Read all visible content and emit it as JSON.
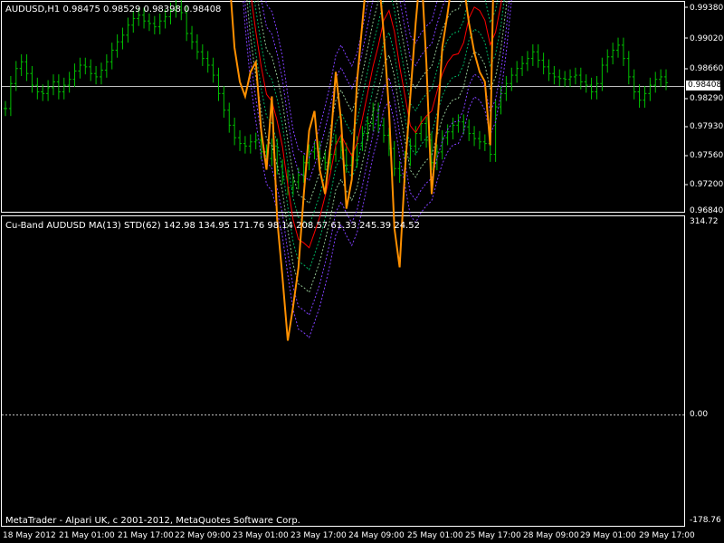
{
  "main_panel": {
    "title": "AUDUSD,H1  0.98475 0.98529 0.98398 0.98408",
    "price_ticks": [
      "0.99380",
      "0.99020",
      "0.98660",
      "0.98290",
      "0.97930",
      "0.97560",
      "0.97200",
      "0.96840"
    ],
    "current_price": "0.98408"
  },
  "indicator_panel": {
    "title": "Cu-Band AUDUSD  MA(13) STD(62)  142.98 134.95 171.76 98.14 208.57 61.33 245.39 24.52",
    "ticks": [
      "314.72",
      "0.00",
      "-178.76"
    ]
  },
  "footer": {
    "copyright": "MetaTrader - Alpari UK, c 2001-2012, MetaQuotes Software Corp."
  },
  "date_axis": [
    "18 May 2012",
    "21 May 01:00",
    "21 May 17:00",
    "22 May 09:00",
    "23 May 01:00",
    "23 May 17:00",
    "24 May 09:00",
    "25 May 01:00",
    "25 May 17:00",
    "28 May 09:00",
    "29 May 01:00",
    "29 May 17:00"
  ],
  "colors": {
    "background": "#000000",
    "grid": "#ffffff",
    "bars": "#00c000",
    "line": "#ff9000",
    "ma": "#ff0000",
    "inner_band": "#00b060",
    "mid_band": "#90c090",
    "outer_band": "#8040ff"
  },
  "chart_data": {
    "type": "line",
    "price_ohlc_closes": [
      0.981,
      0.984,
      0.9858,
      0.9866,
      0.9852,
      0.9838,
      0.983,
      0.9828,
      0.9835,
      0.9842,
      0.983,
      0.9838,
      0.9845,
      0.9855,
      0.9862,
      0.986,
      0.9852,
      0.9848,
      0.9856,
      0.9866,
      0.988,
      0.989,
      0.9898,
      0.991,
      0.9918,
      0.9922,
      0.9915,
      0.9912,
      0.9908,
      0.9915,
      0.992,
      0.9928,
      0.9932,
      0.9925,
      0.99,
      0.989,
      0.9878,
      0.987,
      0.9862,
      0.985,
      0.9828,
      0.9808,
      0.979,
      0.9775,
      0.9768,
      0.9765,
      0.977,
      0.9772,
      0.9758,
      0.975,
      0.9765,
      0.974,
      0.9728,
      0.9715,
      0.9722,
      0.973,
      0.9745,
      0.9758,
      0.9762,
      0.975,
      0.9745,
      0.9755,
      0.977,
      0.976,
      0.9742,
      0.9748,
      0.9768,
      0.978,
      0.9792,
      0.9808,
      0.979,
      0.9778,
      0.9762,
      0.9738,
      0.973,
      0.975,
      0.9765,
      0.978,
      0.9792,
      0.9772,
      0.9745,
      0.9758,
      0.9775,
      0.9782,
      0.979,
      0.9794,
      0.9788,
      0.978,
      0.9774,
      0.977,
      0.9768,
      0.9755,
      0.9812,
      0.9828,
      0.984,
      0.985,
      0.9858,
      0.9864,
      0.987,
      0.9878,
      0.9868,
      0.986,
      0.9852,
      0.9848,
      0.9846,
      0.9845,
      0.9848,
      0.985,
      0.9842,
      0.9838,
      0.983,
      0.984,
      0.9862,
      0.9872,
      0.988,
      0.9886,
      0.987,
      0.9848,
      0.983,
      0.982,
      0.9828,
      0.9838,
      0.9845,
      0.9848,
      0.9841
    ],
    "indicator_ylim": [
      -178.76,
      314.72
    ],
    "price_ylim": [
      0.9684,
      0.9938
    ]
  }
}
